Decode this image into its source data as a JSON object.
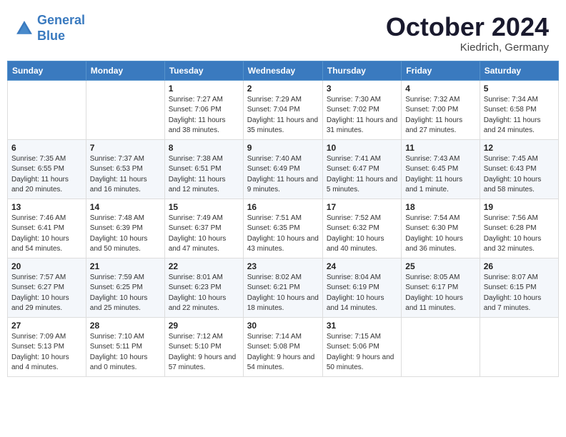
{
  "header": {
    "logo_line1": "General",
    "logo_line2": "Blue",
    "month": "October 2024",
    "location": "Kiedrich, Germany"
  },
  "weekdays": [
    "Sunday",
    "Monday",
    "Tuesday",
    "Wednesday",
    "Thursday",
    "Friday",
    "Saturday"
  ],
  "weeks": [
    [
      {
        "day": "",
        "sunrise": "",
        "sunset": "",
        "daylight": ""
      },
      {
        "day": "",
        "sunrise": "",
        "sunset": "",
        "daylight": ""
      },
      {
        "day": "1",
        "sunrise": "Sunrise: 7:27 AM",
        "sunset": "Sunset: 7:06 PM",
        "daylight": "Daylight: 11 hours and 38 minutes."
      },
      {
        "day": "2",
        "sunrise": "Sunrise: 7:29 AM",
        "sunset": "Sunset: 7:04 PM",
        "daylight": "Daylight: 11 hours and 35 minutes."
      },
      {
        "day": "3",
        "sunrise": "Sunrise: 7:30 AM",
        "sunset": "Sunset: 7:02 PM",
        "daylight": "Daylight: 11 hours and 31 minutes."
      },
      {
        "day": "4",
        "sunrise": "Sunrise: 7:32 AM",
        "sunset": "Sunset: 7:00 PM",
        "daylight": "Daylight: 11 hours and 27 minutes."
      },
      {
        "day": "5",
        "sunrise": "Sunrise: 7:34 AM",
        "sunset": "Sunset: 6:58 PM",
        "daylight": "Daylight: 11 hours and 24 minutes."
      }
    ],
    [
      {
        "day": "6",
        "sunrise": "Sunrise: 7:35 AM",
        "sunset": "Sunset: 6:55 PM",
        "daylight": "Daylight: 11 hours and 20 minutes."
      },
      {
        "day": "7",
        "sunrise": "Sunrise: 7:37 AM",
        "sunset": "Sunset: 6:53 PM",
        "daylight": "Daylight: 11 hours and 16 minutes."
      },
      {
        "day": "8",
        "sunrise": "Sunrise: 7:38 AM",
        "sunset": "Sunset: 6:51 PM",
        "daylight": "Daylight: 11 hours and 12 minutes."
      },
      {
        "day": "9",
        "sunrise": "Sunrise: 7:40 AM",
        "sunset": "Sunset: 6:49 PM",
        "daylight": "Daylight: 11 hours and 9 minutes."
      },
      {
        "day": "10",
        "sunrise": "Sunrise: 7:41 AM",
        "sunset": "Sunset: 6:47 PM",
        "daylight": "Daylight: 11 hours and 5 minutes."
      },
      {
        "day": "11",
        "sunrise": "Sunrise: 7:43 AM",
        "sunset": "Sunset: 6:45 PM",
        "daylight": "Daylight: 11 hours and 1 minute."
      },
      {
        "day": "12",
        "sunrise": "Sunrise: 7:45 AM",
        "sunset": "Sunset: 6:43 PM",
        "daylight": "Daylight: 10 hours and 58 minutes."
      }
    ],
    [
      {
        "day": "13",
        "sunrise": "Sunrise: 7:46 AM",
        "sunset": "Sunset: 6:41 PM",
        "daylight": "Daylight: 10 hours and 54 minutes."
      },
      {
        "day": "14",
        "sunrise": "Sunrise: 7:48 AM",
        "sunset": "Sunset: 6:39 PM",
        "daylight": "Daylight: 10 hours and 50 minutes."
      },
      {
        "day": "15",
        "sunrise": "Sunrise: 7:49 AM",
        "sunset": "Sunset: 6:37 PM",
        "daylight": "Daylight: 10 hours and 47 minutes."
      },
      {
        "day": "16",
        "sunrise": "Sunrise: 7:51 AM",
        "sunset": "Sunset: 6:35 PM",
        "daylight": "Daylight: 10 hours and 43 minutes."
      },
      {
        "day": "17",
        "sunrise": "Sunrise: 7:52 AM",
        "sunset": "Sunset: 6:32 PM",
        "daylight": "Daylight: 10 hours and 40 minutes."
      },
      {
        "day": "18",
        "sunrise": "Sunrise: 7:54 AM",
        "sunset": "Sunset: 6:30 PM",
        "daylight": "Daylight: 10 hours and 36 minutes."
      },
      {
        "day": "19",
        "sunrise": "Sunrise: 7:56 AM",
        "sunset": "Sunset: 6:28 PM",
        "daylight": "Daylight: 10 hours and 32 minutes."
      }
    ],
    [
      {
        "day": "20",
        "sunrise": "Sunrise: 7:57 AM",
        "sunset": "Sunset: 6:27 PM",
        "daylight": "Daylight: 10 hours and 29 minutes."
      },
      {
        "day": "21",
        "sunrise": "Sunrise: 7:59 AM",
        "sunset": "Sunset: 6:25 PM",
        "daylight": "Daylight: 10 hours and 25 minutes."
      },
      {
        "day": "22",
        "sunrise": "Sunrise: 8:01 AM",
        "sunset": "Sunset: 6:23 PM",
        "daylight": "Daylight: 10 hours and 22 minutes."
      },
      {
        "day": "23",
        "sunrise": "Sunrise: 8:02 AM",
        "sunset": "Sunset: 6:21 PM",
        "daylight": "Daylight: 10 hours and 18 minutes."
      },
      {
        "day": "24",
        "sunrise": "Sunrise: 8:04 AM",
        "sunset": "Sunset: 6:19 PM",
        "daylight": "Daylight: 10 hours and 14 minutes."
      },
      {
        "day": "25",
        "sunrise": "Sunrise: 8:05 AM",
        "sunset": "Sunset: 6:17 PM",
        "daylight": "Daylight: 10 hours and 11 minutes."
      },
      {
        "day": "26",
        "sunrise": "Sunrise: 8:07 AM",
        "sunset": "Sunset: 6:15 PM",
        "daylight": "Daylight: 10 hours and 7 minutes."
      }
    ],
    [
      {
        "day": "27",
        "sunrise": "Sunrise: 7:09 AM",
        "sunset": "Sunset: 5:13 PM",
        "daylight": "Daylight: 10 hours and 4 minutes."
      },
      {
        "day": "28",
        "sunrise": "Sunrise: 7:10 AM",
        "sunset": "Sunset: 5:11 PM",
        "daylight": "Daylight: 10 hours and 0 minutes."
      },
      {
        "day": "29",
        "sunrise": "Sunrise: 7:12 AM",
        "sunset": "Sunset: 5:10 PM",
        "daylight": "Daylight: 9 hours and 57 minutes."
      },
      {
        "day": "30",
        "sunrise": "Sunrise: 7:14 AM",
        "sunset": "Sunset: 5:08 PM",
        "daylight": "Daylight: 9 hours and 54 minutes."
      },
      {
        "day": "31",
        "sunrise": "Sunrise: 7:15 AM",
        "sunset": "Sunset: 5:06 PM",
        "daylight": "Daylight: 9 hours and 50 minutes."
      },
      {
        "day": "",
        "sunrise": "",
        "sunset": "",
        "daylight": ""
      },
      {
        "day": "",
        "sunrise": "",
        "sunset": "",
        "daylight": ""
      }
    ]
  ]
}
